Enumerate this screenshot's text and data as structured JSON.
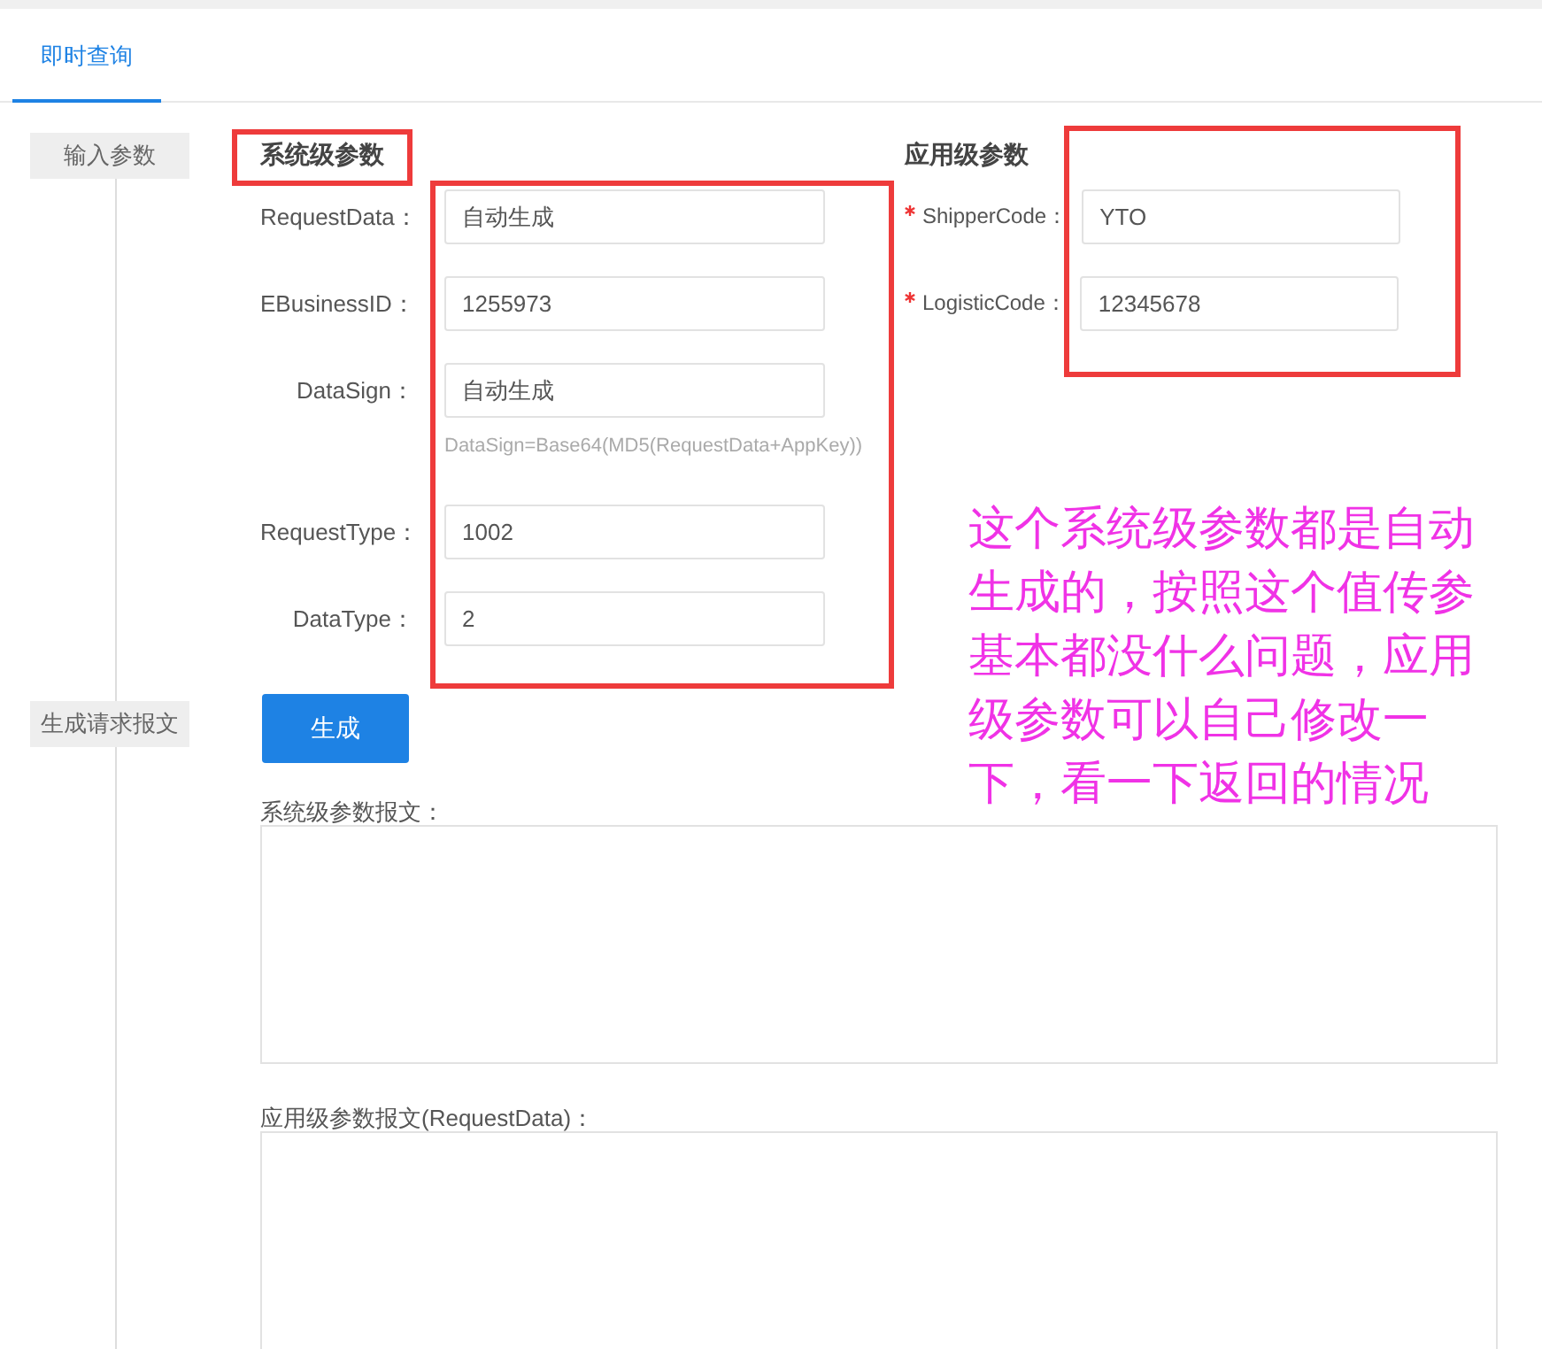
{
  "tabs": [
    {
      "label": "即时查询",
      "selected": true
    }
  ],
  "steps": [
    {
      "label": "输入参数"
    },
    {
      "label": "生成请求报文"
    }
  ],
  "system_params": {
    "heading": "系统级参数",
    "heading_framed": true,
    "fields_framed": true,
    "fields": [
      {
        "label": "RequestData：",
        "value": "自动生成",
        "required": false
      },
      {
        "label": "EBusinessID：",
        "value": "1255973",
        "required": false
      },
      {
        "label": "DataSign：",
        "value": "自动生成",
        "required": false,
        "hint": "DataSign=Base64(MD5(RequestData+AppKey))"
      },
      {
        "label": "RequestType：",
        "value": "1002",
        "required": false
      },
      {
        "label": "DataType：",
        "value": "2",
        "required": false
      }
    ]
  },
  "app_params": {
    "heading": "应用级参数",
    "fields_framed": true,
    "fields": [
      {
        "label": "ShipperCode：",
        "value": "YTO",
        "required": true
      },
      {
        "label": "LogisticCode：",
        "value": "12345678",
        "required": true
      }
    ]
  },
  "generate_button": "生成",
  "outputs": [
    {
      "label": "系统级参数报文："
    },
    {
      "label": "应用级参数报文(RequestData)："
    }
  ],
  "annotation": {
    "lines": [
      "这个系统级参数都是自动",
      "生成的，按照这个值传参",
      "基本都没什么问题，应用",
      "级参数可以自己修改一",
      "下，看一下返回的情况"
    ]
  }
}
